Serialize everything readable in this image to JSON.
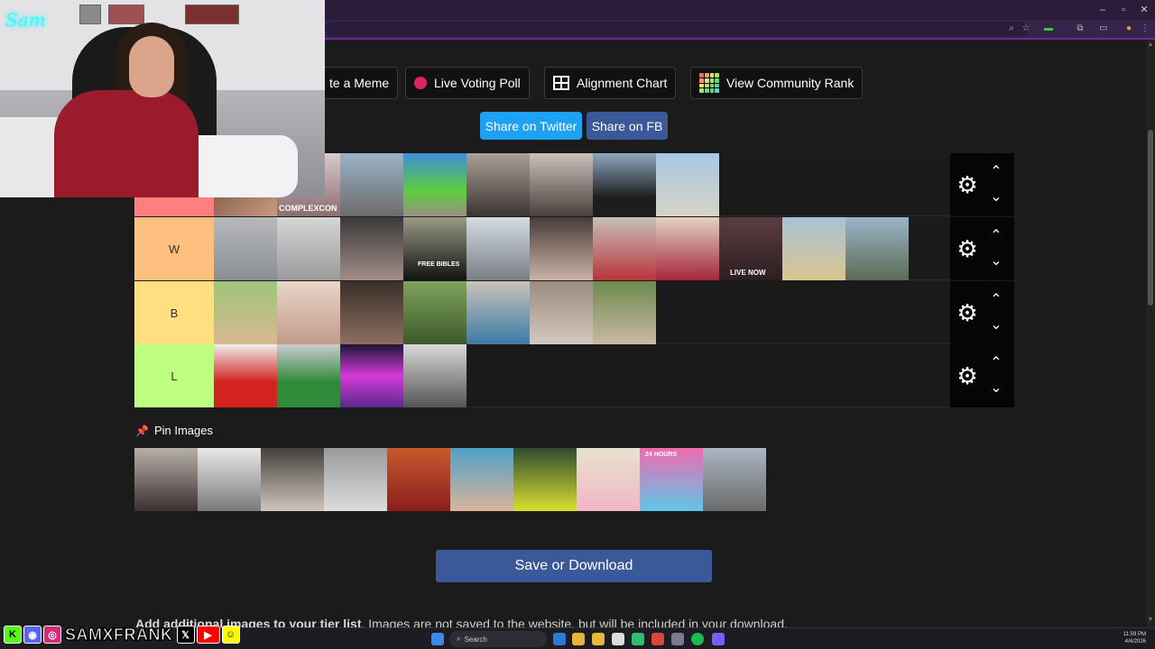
{
  "buttons": {
    "meme": "te a Meme",
    "live_poll": "Live Voting Poll",
    "alignment": "Alignment Chart",
    "community_rank": "View Community Rank",
    "share_twitter": "Share on Twitter",
    "share_fb": "Share on FB",
    "save": "Save or Download"
  },
  "colors": {
    "twitter": "#1da1f2",
    "facebook": "#3b5998",
    "tier_first": "#ff7f7f",
    "tier_w": "#ffbf7f",
    "tier_b": "#ffdf7f",
    "tier_l": "#bfff7f"
  },
  "tiers": [
    {
      "label": "",
      "color": "#ff7f7f"
    },
    {
      "label": "W",
      "color": "#ffbf7f"
    },
    {
      "label": "B",
      "color": "#ffdf7f"
    },
    {
      "label": "L",
      "color": "#bfff7f"
    }
  ],
  "thumb_text": {
    "complexcon": "COMPLEXCON",
    "free_bibles": "FREE BIBLES",
    "live_now": "LIVE NOW",
    "hours": "24 HOURS"
  },
  "pin": {
    "title": "Pin Images",
    "icon": "pushpin-icon"
  },
  "bottom_text": {
    "bold": "Add additional images to your tier list",
    "rest": ". Images are not saved to the website, but will be included in your download."
  },
  "webcam": {
    "logo": "Sam"
  },
  "social": {
    "handle": "SAMXFRANK"
  },
  "taskbar": {
    "search": "Search",
    "time": "11:59 PM",
    "date": "4/4/2026"
  }
}
